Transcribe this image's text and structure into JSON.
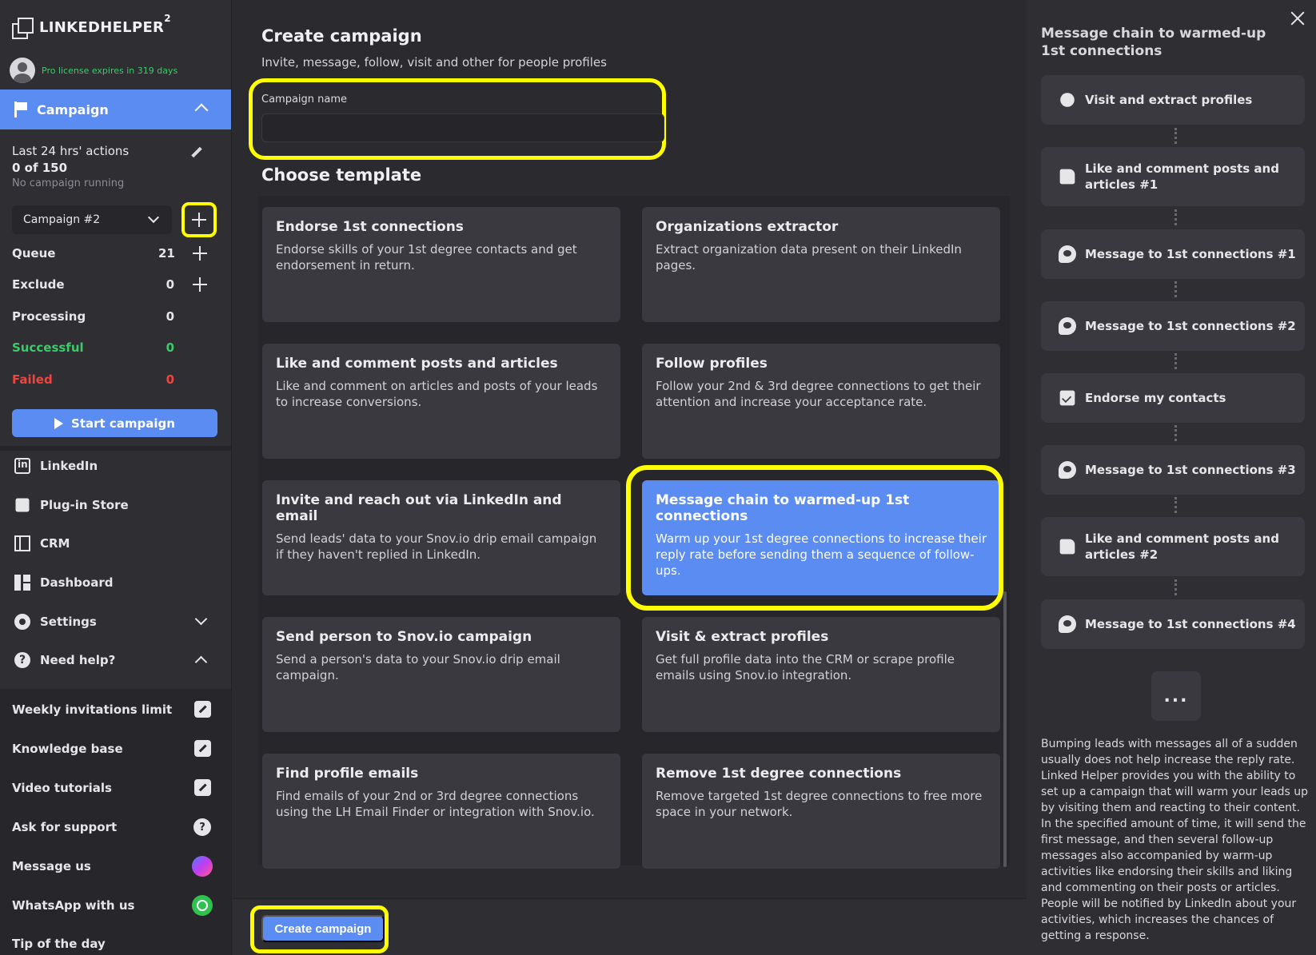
{
  "sidebar": {
    "logo": "LINKEDHELPER",
    "logo_sup": "2",
    "license": "Pro license expires in 319 days",
    "campaign_header": "Campaign",
    "last_actions": "Last 24 hrs' actions",
    "actions_count": "0 of 150",
    "running_status": "No campaign running",
    "campaign_select": "Campaign #2",
    "stats": [
      {
        "label": "Queue",
        "value": "21"
      },
      {
        "label": "Exclude",
        "value": "0"
      },
      {
        "label": "Processing",
        "value": "0"
      },
      {
        "label": "Successful",
        "value": "0"
      },
      {
        "label": "Failed",
        "value": "0"
      }
    ],
    "start_button": "Start campaign",
    "nav": [
      {
        "label": "LinkedIn",
        "icon": "linkedin-icon"
      },
      {
        "label": "Plug-in Store",
        "icon": "puzzle-icon"
      },
      {
        "label": "CRM",
        "icon": "crm-icon"
      },
      {
        "label": "Dashboard",
        "icon": "dashboard-icon"
      },
      {
        "label": "Settings",
        "icon": "gear-icon"
      },
      {
        "label": "Need help?",
        "icon": "help-icon"
      }
    ],
    "help_items": [
      {
        "label": "Weekly invitations limit",
        "icon": "external-link-icon"
      },
      {
        "label": "Knowledge base",
        "icon": "external-link-icon"
      },
      {
        "label": "Video tutorials",
        "icon": "external-link-icon"
      },
      {
        "label": "Ask for support",
        "icon": "question-icon"
      },
      {
        "label": "Message us",
        "icon": "messenger-icon"
      },
      {
        "label": "WhatsApp with us",
        "icon": "whatsapp-icon"
      },
      {
        "label": "Tip of the day",
        "icon": ""
      }
    ]
  },
  "main": {
    "title": "Create campaign",
    "subtitle": "Invite, message, follow, visit and other for people profiles",
    "name_label": "Campaign name",
    "name_value": "",
    "template_heading": "Choose template",
    "templates": [
      {
        "title": "Endorse 1st connections",
        "desc": "Endorse skills of your 1st degree contacts and get endorsement in return."
      },
      {
        "title": "Organizations extractor",
        "desc": "Extract organization data present on their LinkedIn pages."
      },
      {
        "title": "Like and comment posts and articles",
        "desc": "Like and comment on articles and posts of your leads to increase conversions."
      },
      {
        "title": "Follow profiles",
        "desc": "Follow your 2nd & 3rd degree connections to get their attention and increase your acceptance rate."
      },
      {
        "title": "Invite and reach out via LinkedIn and email",
        "desc": "Send leads' data to your Snov.io drip email campaign if they haven't replied in LinkedIn."
      },
      {
        "title": "Message chain to warmed-up 1st connections",
        "desc": "Warm up your 1st degree connections to increase their reply rate before sending them a sequence of follow-ups."
      },
      {
        "title": "Send person to Snov.io campaign",
        "desc": "Send a person's data to your Snov.io drip email campaign."
      },
      {
        "title": "Visit & extract profiles",
        "desc": "Get full profile data into the CRM or scrape profile emails using Snov.io integration."
      },
      {
        "title": "Find profile emails",
        "desc": "Find emails of your 2nd or 3rd degree connections using the LH Email Finder or integration with Snov.io."
      },
      {
        "title": "Remove 1st degree connections",
        "desc": "Remove targeted 1st degree connections to free more space in your network."
      }
    ],
    "create_button": "Create campaign"
  },
  "panel": {
    "title": "Message chain to warmed-up 1st connections",
    "steps": [
      {
        "label": "Visit and extract profiles",
        "icon": "visit-icon"
      },
      {
        "label": "Like and comment posts and articles #1",
        "icon": "like-icon"
      },
      {
        "label": "Message to 1st connections #1",
        "icon": "message-icon"
      },
      {
        "label": "Message to 1st connections #2",
        "icon": "message-icon"
      },
      {
        "label": "Endorse my contacts",
        "icon": "endorse-icon"
      },
      {
        "label": "Message to 1st connections #3",
        "icon": "message-icon"
      },
      {
        "label": "Like and comment posts and articles #2",
        "icon": "like-icon"
      },
      {
        "label": "Message to 1st connections #4",
        "icon": "message-icon"
      }
    ],
    "more": "...",
    "description": "Bumping leads with messages all of a sudden usually does not help increase the reply rate. Linked Helper provides you with the ability to set up a campaign that will warm your leads up by visiting them and reacting to their content. In the specified amount of time, it will send the first message, and then several follow-up messages also accompanied by warm-up activities like endorsing their skills and liking and commenting on their posts or articles. People will be notified by LinkedIn about your activities, which increases the chances of getting a response."
  },
  "colors": {
    "accent": "#5b8cf2",
    "highlight": "#ffff00",
    "success": "#3ec96a",
    "danger": "#f0453e"
  }
}
